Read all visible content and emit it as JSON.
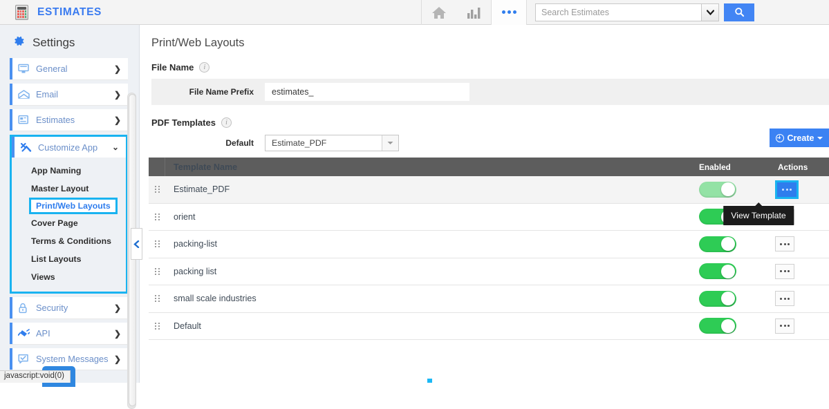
{
  "topbar": {
    "brand_icon": "calculator-icon",
    "brand_title": "ESTIMATES",
    "home_icon": "home-icon",
    "reports_icon": "bar-chart-icon",
    "more_icon": "ellipsis-icon",
    "search_placeholder": "Search Estimates",
    "search_value": "",
    "search_dropdown_icon": "chevron-down-icon",
    "search_button_icon": "search-icon"
  },
  "sidebar": {
    "title": "Settings",
    "title_icon": "gear-icon",
    "items": [
      {
        "label": "General",
        "icon": "monitor-icon",
        "chevron": "❯"
      },
      {
        "label": "Email",
        "icon": "envelope-icon",
        "chevron": "❯"
      },
      {
        "label": "Estimates",
        "icon": "document-icon",
        "chevron": "❯"
      }
    ],
    "customize": {
      "label": "Customize App",
      "icon": "wrench-icon",
      "chevron": "⌄",
      "expanded": true,
      "highlight_color": "#19b3f0",
      "submenu": [
        {
          "label": "App Naming",
          "active": false
        },
        {
          "label": "Master Layout",
          "active": false
        },
        {
          "label": "Print/Web Layouts",
          "active": true
        },
        {
          "label": "Cover Page",
          "active": false
        },
        {
          "label": "Terms & Conditions",
          "active": false
        },
        {
          "label": "List Layouts",
          "active": false
        },
        {
          "label": "Views",
          "active": false
        }
      ]
    },
    "items_after": [
      {
        "label": "Security",
        "icon": "lock-icon",
        "chevron": "❯"
      },
      {
        "label": "API",
        "icon": "plug-icon",
        "chevron": "❯"
      },
      {
        "label": "System Messages",
        "icon": "message-check-icon",
        "chevron": "❯"
      }
    ],
    "scroll_top_icon": "chevron-up-icon",
    "collapse_icon": "chevron-left-icon"
  },
  "main": {
    "page_title": "Print/Web Layouts",
    "file_name": {
      "section_label": "File Name",
      "info_icon": "info-icon",
      "prefix_label": "File Name Prefix",
      "prefix_value": "estimates_"
    },
    "pdf_templates": {
      "section_label": "PDF Templates",
      "info_icon": "info-icon",
      "default_label": "Default",
      "default_value": "Estimate_PDF",
      "default_caret_icon": "caret-down-icon",
      "create_label": "Create",
      "create_icon": "plus-circle-icon",
      "create_caret_icon": "caret-down-icon"
    },
    "table": {
      "columns": [
        "Template Name",
        "Enabled",
        "Actions"
      ],
      "rows": [
        {
          "name": "Estimate_PDF",
          "enabled": true,
          "selected": true,
          "action_icon": "ellipsis-icon",
          "action_active": true
        },
        {
          "name": "orient",
          "enabled": true,
          "selected": false,
          "action_icon": "ellipsis-icon",
          "action_active": false
        },
        {
          "name": "packing-list",
          "enabled": true,
          "selected": false,
          "action_icon": "ellipsis-icon",
          "action_active": false
        },
        {
          "name": "packing list",
          "enabled": true,
          "selected": false,
          "action_icon": "ellipsis-icon",
          "action_active": false
        },
        {
          "name": "small scale industries",
          "enabled": true,
          "selected": false,
          "action_icon": "ellipsis-icon",
          "action_active": false
        },
        {
          "name": "Default",
          "enabled": true,
          "selected": false,
          "action_icon": "ellipsis-icon",
          "action_active": false
        }
      ],
      "row_handle_icon": "drag-handle-icon"
    },
    "tooltip": "View Template",
    "loading_indicator": "loading-square"
  },
  "status_bar": {
    "text": "javascript:void(0)"
  },
  "colors": {
    "accent_blue": "#2f7ded",
    "brand_blue": "#3a7bf0",
    "highlight_cyan": "#19b3f0",
    "toggle_green": "#2ecc55",
    "toggle_green_pale": "#93e2a5",
    "header_gray": "#5d5d5d"
  }
}
